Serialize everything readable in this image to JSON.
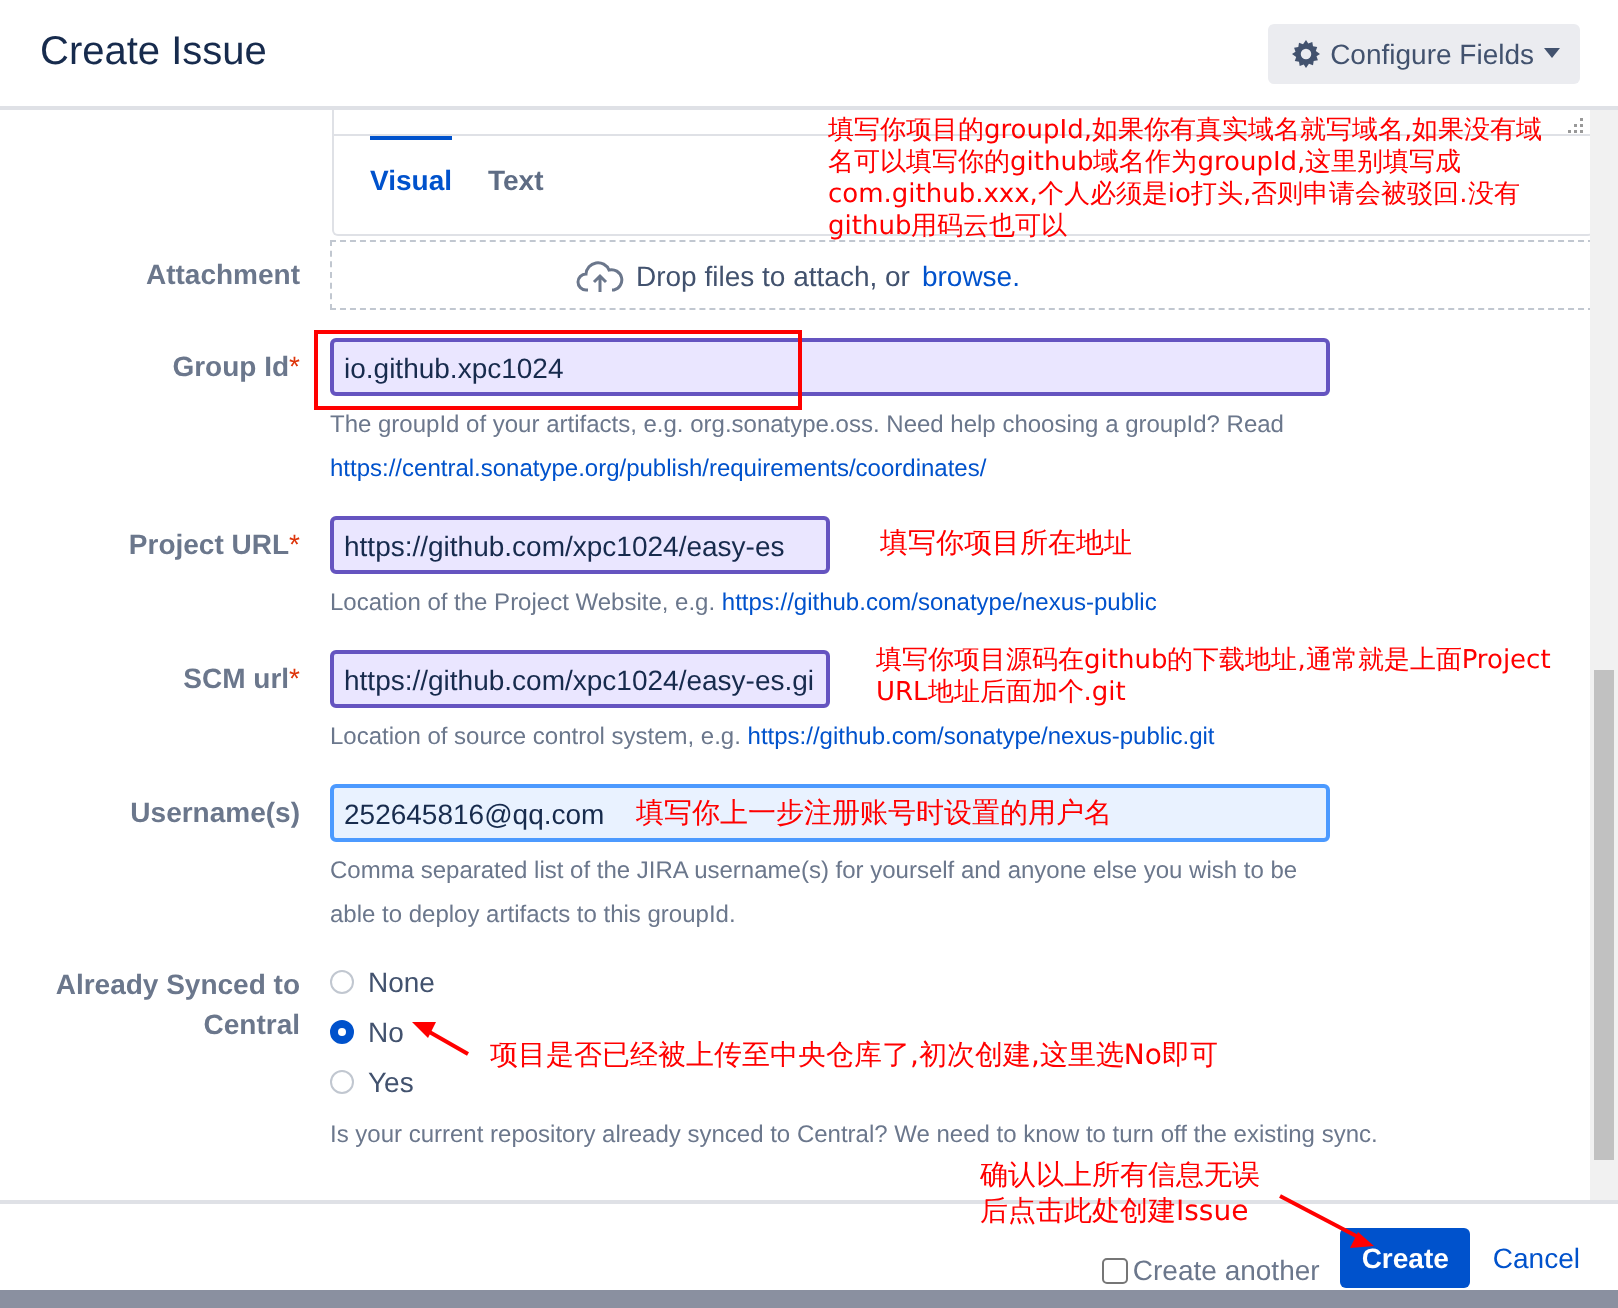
{
  "dialog": {
    "title": "Create Issue",
    "configure_button": "Configure Fields"
  },
  "editor": {
    "tabs": [
      {
        "label": "Visual",
        "selected": true
      },
      {
        "label": "Text",
        "selected": false
      }
    ]
  },
  "fields": [
    {
      "kind": "attachment",
      "label": "Attachment",
      "drop_text": "Drop files to attach, or",
      "browse_link": "browse."
    },
    {
      "kind": "text",
      "label": "Group Id",
      "required_mark": "*",
      "value": "io.github.xpc1024",
      "focused": false,
      "help": "The groupId of your artifacts, e.g. org.sonatype.oss. Need help choosing a groupId? Read",
      "help_link": "https://central.sonatype.org/publish/requirements/coordinates/"
    },
    {
      "kind": "url",
      "label": "Project URL",
      "required_mark": "*",
      "value": "https://github.com/xpc1024/easy-es",
      "focused": false,
      "help": "Location of the Project Website, e.g.",
      "help_link": "https://github.com/sonatype/nexus-public"
    },
    {
      "kind": "url",
      "label": "SCM url",
      "required_mark": "*",
      "value": "https://github.com/xpc1024/easy-es.gi",
      "focused": false,
      "help": "Location of source control system, e.g.",
      "help_link": "https://github.com/sonatype/nexus-public.git"
    },
    {
      "kind": "text",
      "label": "Username(s)",
      "value": "252645816@qq.com",
      "focused": true,
      "help": "Comma separated list of the JIRA username(s) for yourself and anyone else you wish to be able to deploy artifacts to this groupId."
    },
    {
      "kind": "radio",
      "label": "Already Synced to Central",
      "options": [
        {
          "label": "None",
          "selected": false
        },
        {
          "label": "No",
          "selected": true
        },
        {
          "label": "Yes",
          "selected": false
        }
      ],
      "help": "Is your current repository already synced to Central? We need to know to turn off the existing sync."
    }
  ],
  "footer": {
    "create_another": {
      "label": "Create another",
      "checked": false
    },
    "create_button": "Create",
    "cancel_link": "Cancel"
  },
  "annotations": [
    {
      "text": "填写你项目的groupId,如果你有真实域名就写域名,如果没有域名可以填写你的github域名作为groupId,这里别填写成com.github.xxx,个人必须是io打头,否则申请会被驳回.没有github用码云也可以"
    },
    {
      "text": "填写你项目所在地址"
    },
    {
      "text": "填写你项目源码在github的下载地址,通常就是上面Project URL地址后面加个.git"
    },
    {
      "text": "填写你上一步注册账号时设置的用户名"
    },
    {
      "text": "项目是否已经被上传至中央仓库了,初次创建,这里选No即可"
    },
    {
      "text": "确认以上所有信息无误后点击此处创建Issue"
    }
  ]
}
